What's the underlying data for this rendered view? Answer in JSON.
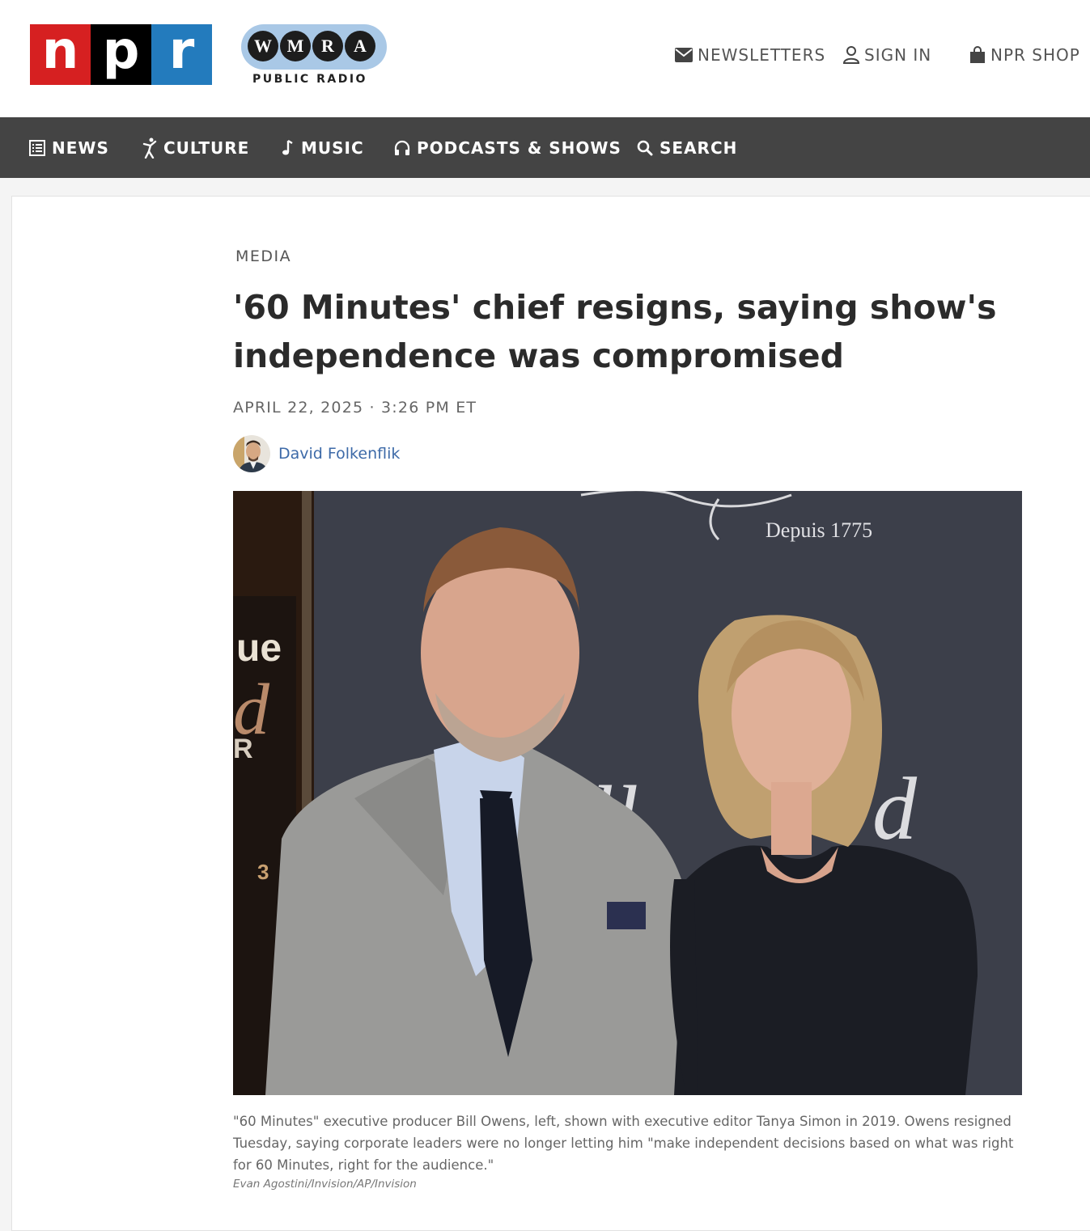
{
  "header": {
    "npr_logo": {
      "letters": [
        "n",
        "p",
        "r"
      ],
      "colors": [
        "#d62021",
        "#000000",
        "#237bbd"
      ]
    },
    "station": {
      "letters": [
        "W",
        "M",
        "R",
        "A"
      ],
      "subtitle": "PUBLIC RADIO",
      "accent": "#a9c8e6"
    },
    "utility_links": [
      {
        "label": "NEWSLETTERS",
        "icon": "envelope-icon"
      },
      {
        "label": "SIGN IN",
        "icon": "user-icon"
      },
      {
        "label": "NPR SHOP",
        "icon": "shopping-bag-icon"
      }
    ]
  },
  "nav": {
    "background": "#444444",
    "items": [
      {
        "label": "NEWS",
        "icon": "news-list-icon"
      },
      {
        "label": "CULTURE",
        "icon": "dancer-icon"
      },
      {
        "label": "MUSIC",
        "icon": "music-note-icon"
      },
      {
        "label": "PODCASTS & SHOWS",
        "icon": "headphones-icon"
      },
      {
        "label": "SEARCH",
        "icon": "search-icon"
      }
    ]
  },
  "article": {
    "section": "MEDIA",
    "headline": "'60 Minutes' chief resigns, saying show's independence was compromised",
    "dateline": "APRIL 22, 2025 · 3:26 PM ET",
    "author": "David Folkenflik",
    "photo": {
      "backdrop_text_top": "Depuis 1775",
      "caption": "\"60 Minutes\" executive producer Bill Owens, left, shown with executive editor Tanya Simon in 2019. Owens resigned Tuesday, saying corporate leaders were no longer letting him \"make independent decisions based on what was right for 60 Minutes, right for the audience.\"",
      "credit": "Evan Agostini/Invision/AP/Invision"
    }
  }
}
